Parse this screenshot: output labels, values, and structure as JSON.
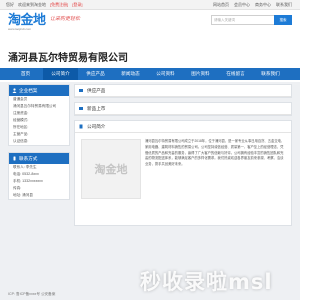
{
  "topbar": {
    "left": [
      "您好",
      "欢迎来到淘金地",
      "[免费注册]",
      "[登录]"
    ],
    "right": [
      "网站首页",
      "会员中心",
      "商务中心",
      "联系我们"
    ]
  },
  "header": {
    "logo_text": "淘金地",
    "logo_url": "www.taojindi.com",
    "slogan": "让采购更轻松",
    "search_placeholder": "请输入关键词",
    "search_button": "搜索"
  },
  "company": {
    "name": "涌河县瓦尔特贸易有限公司"
  },
  "nav": {
    "items": [
      "首页",
      "公司简介",
      "供应产品",
      "新闻动态",
      "公司资料",
      "图片资料",
      "在线留言",
      "联系我们"
    ],
    "active_index": 1
  },
  "left": {
    "info_title": "企业档案",
    "info_rows": [
      "普通会员",
      "涌河县瓦尔特贸易有限公司",
      "注册资金:",
      "经营模式:",
      "所在地区:",
      "主营产品:",
      "认证信息:"
    ],
    "contact_title": "联系方式",
    "contact_rows": [
      "联系人: 李先生",
      "电话: 0532-8xxx",
      "手机: 1332xxxxxxx",
      "传真:",
      "地址: 涌河县"
    ]
  },
  "right": {
    "supply_title": "供应产品",
    "new_title": "新品上市",
    "intro_title": "公司简介",
    "intro_image_text": "淘金地",
    "intro_text": "涌河县瓦尔特贸易有限公司成立于2018年，位于涌河县，是一家专业从事日用百货、五金交电、家用电器、建筑材料销售的贸易公司。公司坚持诚信经营、质量第一、客户至上的经营理念，凭借优质的产品和完善的服务，赢得了广大客户的信赖与好评。公司拥有经验丰富的销售团队和完善的物流配送体系，能够满足客户的多样化需求。我们热诚欢迎各界朋友前来参观、考察、洽谈业务，携手共创美好未来。"
  },
  "watermark": "秒收录啦msl",
  "footer": "ICP: 鲁ICP备xxxx号 公安备案"
}
